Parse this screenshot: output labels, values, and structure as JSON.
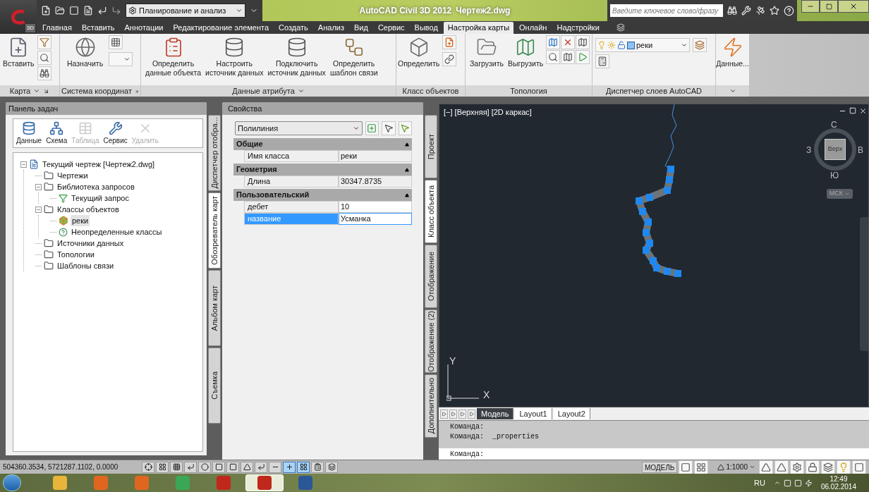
{
  "title_bar": {
    "app_badge": "3D",
    "workspace": "Планирование и анализ",
    "app_name": "AutoCAD Civil 3D 2012",
    "file_name": "Чертеж2.dwg",
    "search_placeholder": "Введите ключевое слово/фразу"
  },
  "menu_tabs": [
    {
      "label": "Главная",
      "selected": false
    },
    {
      "label": "Вставить",
      "selected": false
    },
    {
      "label": "Аннотации",
      "selected": false
    },
    {
      "label": "Редактирование элемента",
      "selected": false
    },
    {
      "label": "Создать",
      "selected": false
    },
    {
      "label": "Анализ",
      "selected": false
    },
    {
      "label": "Вид",
      "selected": false
    },
    {
      "label": "Сервис",
      "selected": false
    },
    {
      "label": "Вывод",
      "selected": false
    },
    {
      "label": "Настройка карты",
      "selected": true
    },
    {
      "label": "Онлайн",
      "selected": false
    },
    {
      "label": "Надстройки",
      "selected": false
    }
  ],
  "ribbon": [
    {
      "kind": "map",
      "title": "Карта",
      "menu": true,
      "launcher": true,
      "buttons": [
        "Вставить"
      ]
    },
    {
      "kind": "coord",
      "title": "Система координат",
      "menu": false,
      "launcher": true,
      "buttons": [
        "Назначить"
      ]
    },
    {
      "kind": "attribute",
      "title": "Данные атрибута",
      "menu": true,
      "launcher": false,
      "buttons": [
        "Определить\nданные объекта",
        "Настроить\nисточник данных",
        "Подключить\nисточник данных",
        "Определить\nшаблон связи"
      ]
    },
    {
      "kind": "class",
      "title": "Класс объектов",
      "menu": false,
      "launcher": false,
      "buttons": [
        "Определить"
      ]
    },
    {
      "kind": "topology",
      "title": "Топология",
      "menu": false,
      "launcher": false,
      "buttons": [
        "Загрузить",
        "Выгрузить"
      ]
    },
    {
      "kind": "layers",
      "title": "Диспетчер слоев AutoCAD",
      "menu": false,
      "launcher": false,
      "layer": "реки"
    },
    {
      "kind": "more",
      "menu": true,
      "launcher": false,
      "buttons": [
        "Данные..."
      ]
    }
  ],
  "task_panel": {
    "title": "Панель задач",
    "toolbar": [
      {
        "kind": "data",
        "label": "Данные",
        "disabled": false
      },
      {
        "kind": "schema",
        "label": "Схема",
        "disabled": false
      },
      {
        "kind": "table",
        "label": "Таблица",
        "disabled": true
      },
      {
        "kind": "tools",
        "label": "Сервис",
        "disabled": false
      },
      {
        "kind": "delete",
        "label": "Удалить",
        "disabled": true
      }
    ],
    "tree": [
      {
        "label": "Текущий чертеж [Чертеж2.dwg]",
        "kind": "drawing",
        "expanded": true,
        "selected": false,
        "children": [
          {
            "label": "Чертежи",
            "kind": "folder",
            "selected": false
          },
          {
            "label": "Библиотека запросов",
            "kind": "folder",
            "expanded": true,
            "selected": false,
            "children": [
              {
                "label": "Текущий запрос",
                "kind": "query",
                "selected": false
              }
            ]
          },
          {
            "label": "Классы объектов",
            "kind": "folder",
            "expanded": true,
            "selected": false,
            "children": [
              {
                "label": "реки",
                "kind": "class",
                "selected": true
              },
              {
                "label": "Неопределенные классы",
                "kind": "unknown",
                "selected": false
              }
            ]
          },
          {
            "label": "Источники данных",
            "kind": "folder",
            "selected": false
          },
          {
            "label": "Топологии",
            "kind": "folder",
            "selected": false
          },
          {
            "label": "Шаблоны связи",
            "kind": "folder",
            "selected": false
          }
        ]
      }
    ],
    "side_tabs": [
      {
        "label": "Диспетчер отобра...",
        "selected": false
      },
      {
        "label": "Обозреватель карт",
        "selected": true
      },
      {
        "label": "Альбом карт",
        "selected": false
      },
      {
        "label": "Съемка",
        "selected": false
      }
    ]
  },
  "properties": {
    "title": "Свойства",
    "object_type": "Полилиния",
    "sections": [
      {
        "title": "Общие",
        "expanded": true,
        "rows": [
          {
            "name": "Имя класса",
            "value": "реки",
            "editable": false,
            "selected": false
          }
        ]
      },
      {
        "title": "Геометрия",
        "expanded": true,
        "rows": [
          {
            "name": "Длина",
            "value": "30347.8735",
            "editable": false,
            "selected": false
          }
        ]
      },
      {
        "title": "Пользовательский",
        "expanded": true,
        "rows": [
          {
            "name": "дебет",
            "value": "10",
            "editable": true,
            "selected": false
          },
          {
            "name": "название",
            "value": "Усманка",
            "editable": true,
            "selected": true
          }
        ]
      }
    ],
    "side_tabs": [
      {
        "label": "Проект",
        "selected": false
      },
      {
        "label": "Класс объекта",
        "selected": true
      },
      {
        "label": "Отображение",
        "selected": false
      },
      {
        "label": "Отображение (2)",
        "selected": false
      },
      {
        "label": "Дополнительно",
        "selected": false
      }
    ]
  },
  "viewport": {
    "label": "[−] [Верхняя] [2D каркас]",
    "compass": {
      "north": "С",
      "west": "З",
      "east": "В",
      "south": "Ю",
      "face": "Верх"
    },
    "ucs_menu": "МСК",
    "axis_x": "X",
    "axis_y": "Y"
  },
  "layout_tabs": [
    {
      "label": "Модель",
      "selected": true
    },
    {
      "label": "Layout1",
      "selected": false
    },
    {
      "label": "Layout2",
      "selected": false
    }
  ],
  "command": {
    "history": [
      "Команда:",
      "Команда:  _properties"
    ],
    "prompt": "Команда:"
  },
  "status_bar": {
    "coordinates": "504360.3534, 5721287.1102, 0.0000",
    "toggles": [
      {
        "on": false
      },
      {
        "on": false
      },
      {
        "on": false
      },
      {
        "on": false
      },
      {
        "on": false
      },
      {
        "on": false
      },
      {
        "on": false
      },
      {
        "on": false
      },
      {
        "on": false
      },
      {
        "on": false
      },
      {
        "on": true
      },
      {
        "on": true
      },
      {
        "on": false
      },
      {
        "on": false
      }
    ],
    "space": "МОДЕЛЬ",
    "scale": "1:1000"
  },
  "taskbar": {
    "apps": [
      {
        "kind": "explorer",
        "active": false
      },
      {
        "kind": "media",
        "active": false
      },
      {
        "kind": "firefox",
        "active": false
      },
      {
        "kind": "chrome",
        "active": false
      },
      {
        "kind": "acrobat",
        "active": false
      },
      {
        "kind": "autocad",
        "active": true
      },
      {
        "kind": "word",
        "active": false
      }
    ],
    "language": "RU",
    "time": "12:49",
    "date": "06.02.2014"
  }
}
